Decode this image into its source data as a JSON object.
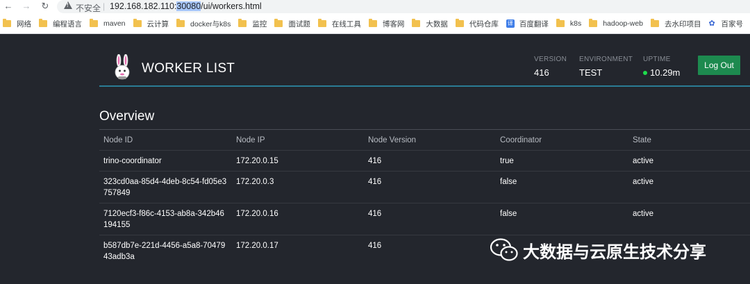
{
  "browser": {
    "insecure_label": "不安全",
    "url_host": "192.168.182.110:",
    "url_port": "30080",
    "url_path": "/ui/workers.html",
    "bookmarks": [
      "网络",
      "编程语言",
      "maven",
      "云计算",
      "docker与k8s",
      "监控",
      "面试题",
      "在线工具",
      "博客网",
      "大数据",
      "代码仓库",
      "百度翻译",
      "k8s",
      "hadoop-web",
      "去水印项目",
      "百家号"
    ]
  },
  "header": {
    "title": "WORKER LIST",
    "version_label": "VERSION",
    "version_value": "416",
    "environment_label": "ENVIRONMENT",
    "environment_value": "TEST",
    "uptime_label": "UPTIME",
    "uptime_value": "10.29m",
    "logout_label": "Log Out"
  },
  "overview": {
    "title": "Overview",
    "columns": [
      "Node ID",
      "Node IP",
      "Node Version",
      "Coordinator",
      "State"
    ],
    "rows": [
      {
        "node_id": "trino-coordinator",
        "node_ip": "172.20.0.15",
        "version": "416",
        "coordinator": "true",
        "state": "active"
      },
      {
        "node_id": "323cd0aa-85d4-4deb-8c54-fd05e3757849",
        "node_ip": "172.20.0.3",
        "version": "416",
        "coordinator": "false",
        "state": "active"
      },
      {
        "node_id": "7120ecf3-f86c-4153-ab8a-342b46194155",
        "node_ip": "172.20.0.16",
        "version": "416",
        "coordinator": "false",
        "state": "active"
      },
      {
        "node_id": "b587db7e-221d-4456-a5a8-7047943adb3a",
        "node_ip": "172.20.0.17",
        "version": "416",
        "coordinator": "",
        "state": ""
      }
    ]
  },
  "watermark": {
    "text": "大数据与云原生技术分享"
  },
  "colors": {
    "background": "#23262d",
    "accent_line": "#2a7c95",
    "logout_button": "#1d8a4f",
    "uptime_dot": "#1edc4c"
  }
}
